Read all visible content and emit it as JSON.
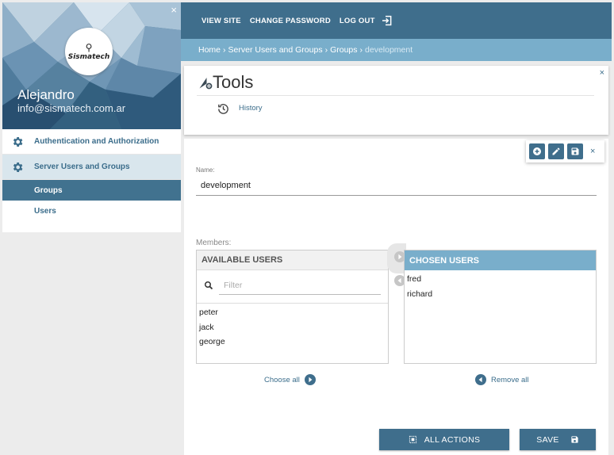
{
  "sidebar": {
    "close_glyph": "×",
    "logo_text": "Sismatech",
    "user_name": "Alejandro",
    "user_email": "info@sismatech.com.ar",
    "items": [
      {
        "label": "Authentication and Authorization",
        "icon": "gear-icon"
      },
      {
        "label": "Server Users and Groups",
        "icon": "gear-icon"
      }
    ],
    "sub_items": [
      {
        "label": "Groups"
      },
      {
        "label": "Users"
      }
    ]
  },
  "topbar": {
    "view_site": "VIEW SITE",
    "change_password": "CHANGE PASSWORD",
    "log_out": "LOG OUT"
  },
  "breadcrumb": {
    "items": [
      "Home",
      "Server Users and Groups",
      "Groups"
    ],
    "current": "development",
    "separator": "›"
  },
  "tools": {
    "title": "Tools",
    "history": "History",
    "close_glyph": "×"
  },
  "form": {
    "close_glyph": "×",
    "name_label": "Name:",
    "name_value": "development",
    "members_label": "Members:",
    "available_title": "AVAILABLE USERS",
    "filter_placeholder": "Filter",
    "available_users": [
      "peter",
      "jack",
      "george"
    ],
    "chosen_title": "CHOSEN USERS",
    "chosen_users": [
      "fred",
      "richard"
    ],
    "choose_all": "Choose all",
    "remove_all": "Remove all",
    "all_actions": "ALL ACTIONS",
    "save": "SAVE"
  },
  "colors": {
    "primary": "#3f6e8c",
    "accent": "#79aecb",
    "link": "#3b6d8b"
  }
}
